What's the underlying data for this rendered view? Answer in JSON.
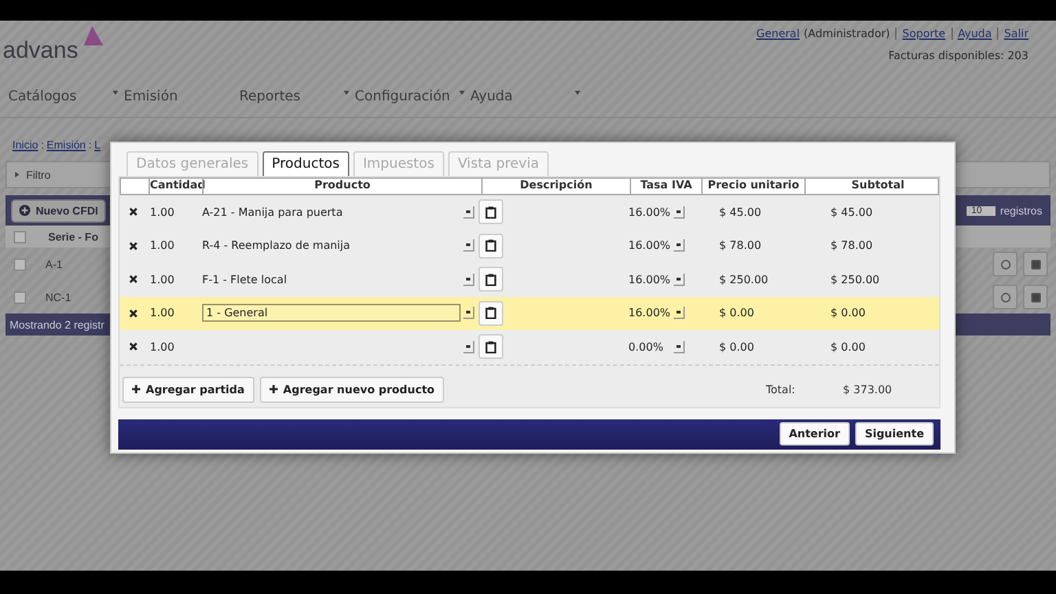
{
  "header": {
    "logo": "advans",
    "user_links": [
      {
        "label": "General",
        "link": true
      },
      {
        "label": "(Administrador)",
        "link": false
      },
      {
        "label": "Soporte",
        "link": true
      },
      {
        "label": "Ayuda",
        "link": true
      },
      {
        "label": "Salir",
        "link": true
      }
    ],
    "invoices_available": "Facturas disponibles: 203"
  },
  "menu": [
    {
      "label": "Catálogos",
      "caret": true
    },
    {
      "label": "Emisión",
      "caret": false
    },
    {
      "label": "Reportes",
      "caret": true
    },
    {
      "label": "Configuración",
      "caret": true
    },
    {
      "label": "Ayuda",
      "caret": true
    }
  ],
  "background": {
    "breadcrumb": [
      {
        "label": "Inicio"
      },
      {
        "separator": ":",
        "label": "Emisión"
      },
      {
        "separator": ":",
        "label": "L"
      }
    ],
    "filter": "Filtro",
    "new_button": "Nuevo CFDI",
    "page_size": "10",
    "page_size_label": "registros",
    "select_all_checked": false,
    "column_1": "Serie - Fo",
    "rows": [
      {
        "serie": "A-1",
        "checked": false
      },
      {
        "serie": "NC-1",
        "checked": false
      }
    ],
    "footer": "Mostrando 2 registr"
  },
  "dialog": {
    "tabs": [
      {
        "label": "Datos generales",
        "selected": false
      },
      {
        "label": "Productos",
        "selected": true
      },
      {
        "label": "Impuestos",
        "selected": false
      },
      {
        "label": "Vista previa",
        "selected": false
      }
    ],
    "columns": [
      "Cantidad",
      "Producto",
      "Descripción",
      "Tasa IVA",
      "Precio unitario",
      "Subtotal"
    ],
    "rows": [
      {
        "quantity": "1.00",
        "product": "A-21 - Manija para puerta",
        "tax": "16.00%",
        "price": "$ 45.00",
        "subtotal": "$ 45.00",
        "selected": false
      },
      {
        "quantity": "1.00",
        "product": "R-4 - Reemplazo de manija",
        "tax": "16.00%",
        "price": "$ 78.00",
        "subtotal": "$ 78.00",
        "selected": false
      },
      {
        "quantity": "1.00",
        "product": "F-1 - Flete local",
        "tax": "16.00%",
        "price": "$ 250.00",
        "subtotal": "$ 250.00",
        "selected": false
      },
      {
        "quantity": "1.00",
        "product": "1 - General",
        "tax": "16.00%",
        "price": "$ 0.00",
        "subtotal": "$ 0.00",
        "selected": true
      },
      {
        "quantity": "1.00",
        "tax": "0.00%",
        "price": "$ 0.00",
        "subtotal": "$ 0.00",
        "selected": false
      }
    ],
    "add_line": "Agregar partida",
    "add_product": "Agregar nuevo producto",
    "total_label": "Total:",
    "total": "$ 373.00",
    "back": "Anterior",
    "next": "Siguiente"
  }
}
